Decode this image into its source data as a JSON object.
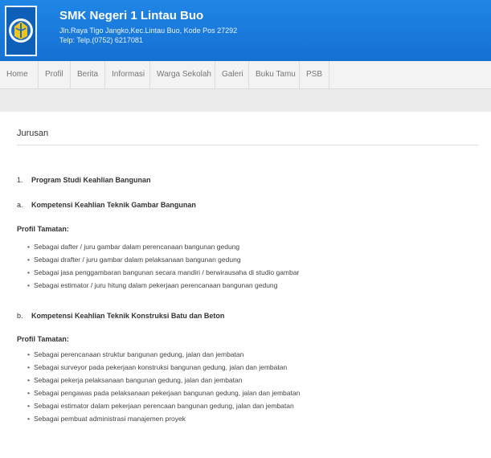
{
  "header": {
    "school_name": "SMK Negeri 1 Lintau Buo",
    "address": "Jln.Raya Tigo Jangko,Kec.Lintau Buo, Kode Pos 27292",
    "phone": "Telp: Telp.(0752) 6217081",
    "logo_icon": "school-emblem-icon"
  },
  "nav": {
    "items": [
      {
        "label": "Home"
      },
      {
        "label": "Profil"
      },
      {
        "label": "Berita"
      },
      {
        "label": "Informasi"
      },
      {
        "label": "Warga Sekolah"
      },
      {
        "label": "Galeri"
      },
      {
        "label": "Buku Tamu"
      },
      {
        "label": "PSB"
      }
    ]
  },
  "content": {
    "page_title": "Jurusan",
    "program": {
      "num": "1.",
      "text": "Program Studi Keahlian Bangunan"
    },
    "sections": [
      {
        "num": "a.",
        "title": "Kompetensi Keahlian Teknik Gambar Bangunan",
        "profile_label": "Profil Tamatan:",
        "items": [
          "Sebagai dafter / juru gambar dalam perencanaan bangunan gedung",
          "Sebagai  drafter / juru gambar dalam pelaksanaan bangunan gedung",
          "Sebagai  jasa penggambaran bangunan secara mandiri / berwirausaha di studio gambar",
          "Sebagai estimator / juru hitung dalam pekerjaan perencanaan bangunan gedung"
        ]
      },
      {
        "num": "b.",
        "title": "Kompetensi Keahlian Teknik Konstruksi Batu dan Beton",
        "profile_label": "Profil Tamatan:",
        "items": [
          "Sebagai perencanaan struktur bangunan gedung, jalan dan jembatan",
          "Sebagai surveyor pada pekerjaan konstruksi bangunan gedung, jalan dan jembatan",
          "Sebagai pekerja pelaksanaan bangunan gedung, jalan dan jembatan",
          "Sebagai pengawas pada pelaksanaan pekerjaan bangunan gedung, jalan dan jembatan",
          "Sebagai estimator dalam pekerjaan perencaan bangunan gedung, jalan dan jembatan",
          "Sebagai pembuat administrasi manajemen proyek"
        ]
      }
    ]
  },
  "colors": {
    "header_bg": "#1a7ddd",
    "nav_bg": "#f3f3f3",
    "stripe_bg": "#ececec"
  }
}
